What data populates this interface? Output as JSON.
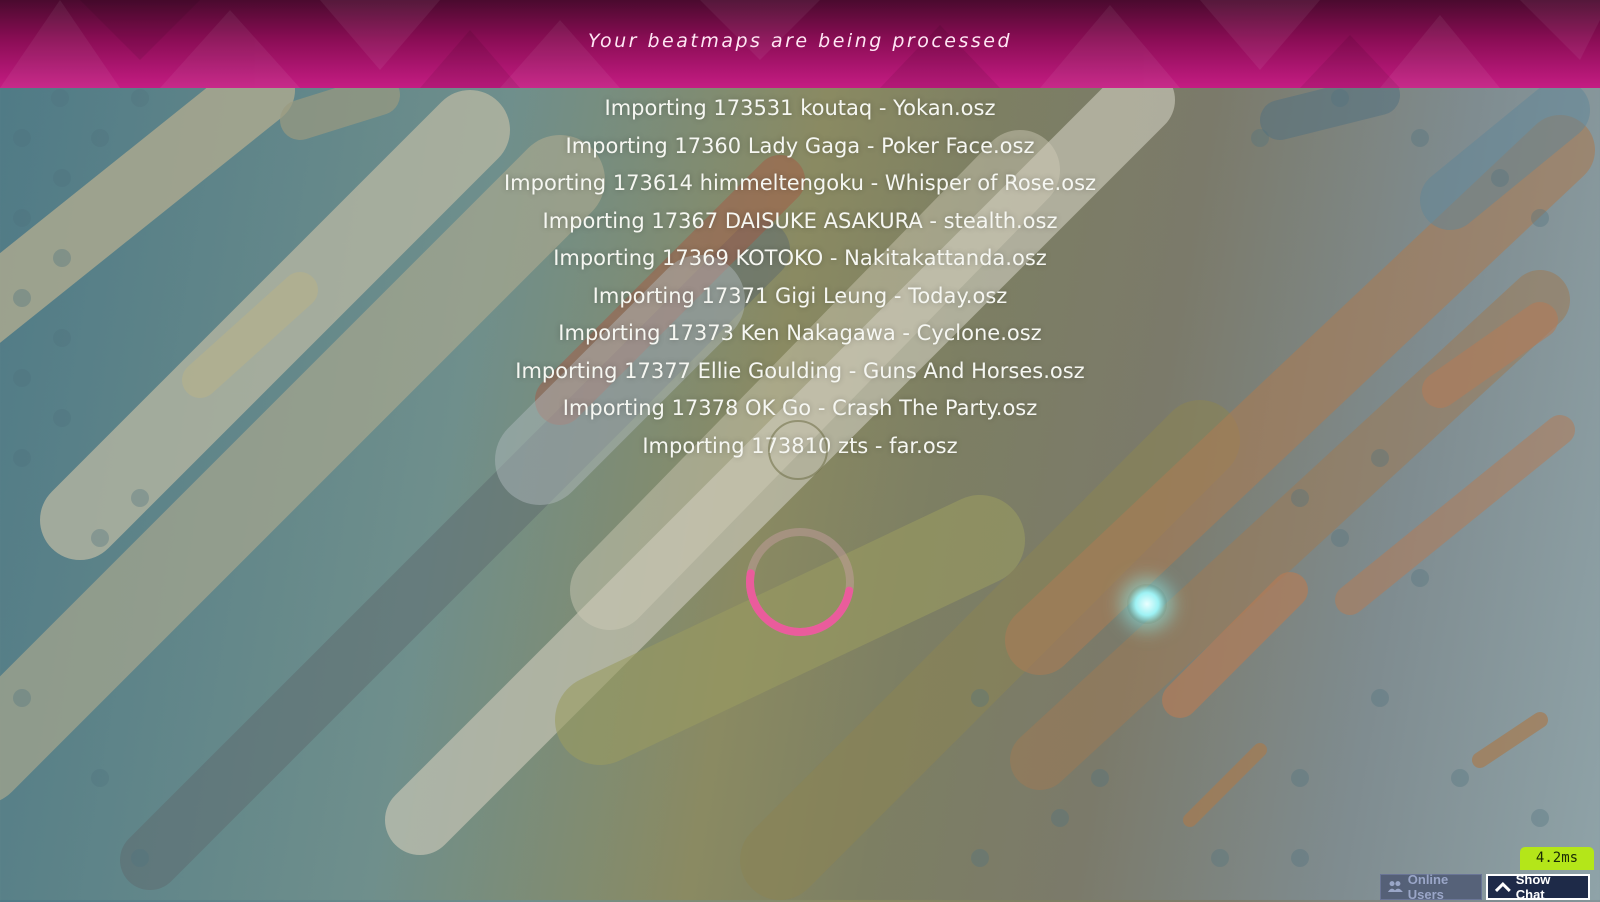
{
  "banner": {
    "title": "Your beatmaps are being processed"
  },
  "imports": [
    "Importing 173531 koutaq - Yokan.osz",
    "Importing 17360 Lady Gaga - Poker Face.osz",
    "Importing 173614 himmeltengoku - Whisper of Rose.osz",
    "Importing 17367 DAISUKE ASAKURA - stealth.osz",
    "Importing 17369 KOTOKO - Nakitakattanda.osz",
    "Importing 17371 Gigi Leung - Today.osz",
    "Importing 17373 Ken Nakagawa - Cyclone.osz",
    "Importing 17377 Ellie Goulding - Guns And Horses.osz",
    "Importing 17378 OK Go - Crash The Party.osz",
    "Importing 173810 zts - far.osz"
  ],
  "fps": "4.2ms",
  "bottom_bar": {
    "online_users_label": "Online Users",
    "show_chat_label": "Show Chat"
  },
  "icons": {
    "online_users": "users-icon",
    "show_chat": "chevron-up-icon"
  },
  "colors": {
    "banner": "#c51c83",
    "spinner": "#ea5c9c",
    "fps_badge": "#b4e619",
    "cursor": "#9ef2f4"
  }
}
